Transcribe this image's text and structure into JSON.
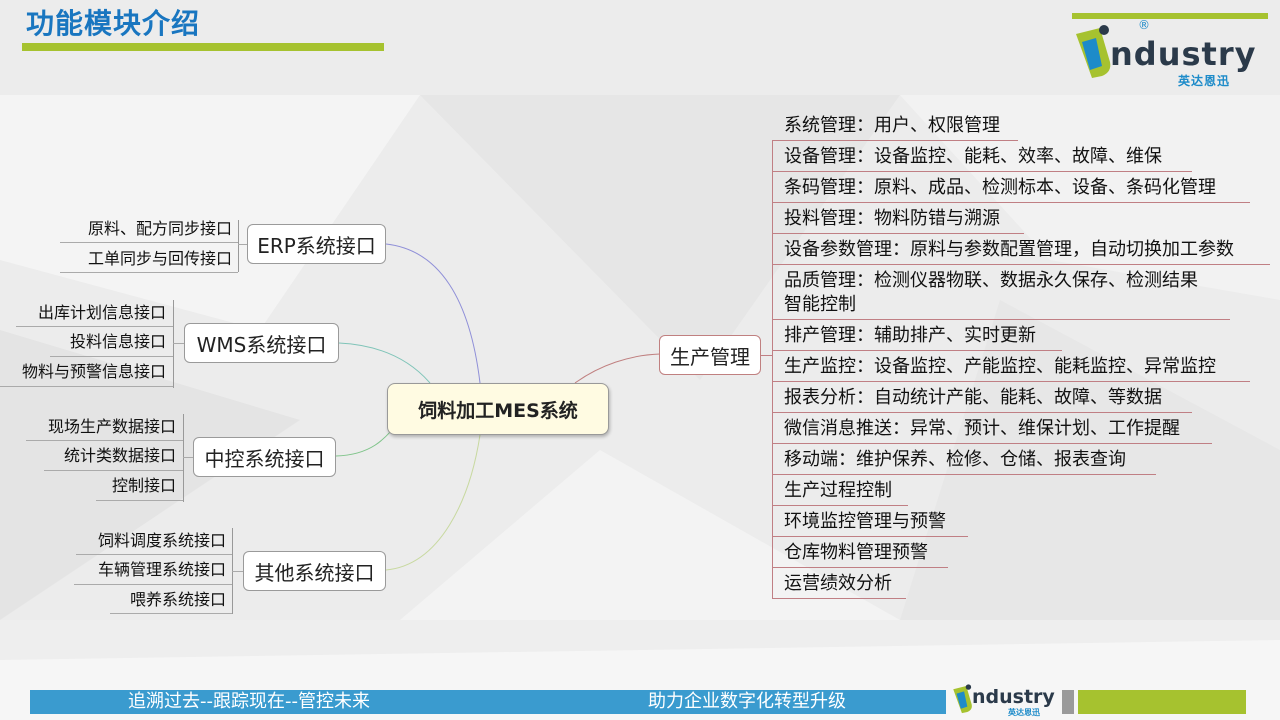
{
  "header": {
    "title": "功能模块介绍"
  },
  "logo": {
    "word": "ndustry",
    "cn": "英达恩迅",
    "reg": "®"
  },
  "mindmap": {
    "central": "饲料加工MES系统",
    "left_branches": [
      {
        "label": "ERP系统接口",
        "items": [
          "原料、配方同步接口",
          "工单同步与回传接口"
        ]
      },
      {
        "label": "WMS系统接口",
        "items": [
          "出库计划信息接口",
          "投料信息接口",
          "物料与预警信息接口"
        ]
      },
      {
        "label": "中控系统接口",
        "items": [
          "现场生产数据接口",
          "统计类数据接口",
          "控制接口"
        ]
      },
      {
        "label": "其他系统接口",
        "items": [
          "饲料调度系统接口",
          "车辆管理系统接口",
          "喂养系统接口"
        ]
      }
    ],
    "right_branch": {
      "label": "生产管理",
      "items": [
        "系统管理：用户、权限管理",
        "设备管理：设备监控、能耗、效率、故障、维保",
        "条码管理：原料、成品、检测标本、设备、条码化管理",
        "投料管理：物料防错与溯源",
        "设备参数管理：原料与参数配置管理，自动切换加工参数",
        "品质管理：检测仪器物联、数据永久保存、检测结果",
        "智能控制",
        "排产管理：辅助排产、实时更新",
        "生产监控：设备监控、产能监控、能耗监控、异常监控",
        "报表分析：自动统计产能、能耗、故障、等数据",
        "微信消息推送：异常、预计、维保计划、工作提醒",
        "移动端：维护保养、检修、仓储、报表查询",
        "生产过程控制",
        "环境监控管理与预警",
        "仓库物料管理预警",
        "运营绩效分析"
      ]
    }
  },
  "footer": {
    "left_text": "追溯过去--跟踪现在--管控未来",
    "right_text": "助力企业数字化转型升级"
  },
  "colors": {
    "title": "#1976c0",
    "accent_green": "#a6c22f",
    "footer_blue": "#3a9bcf",
    "right_lines": "#c07f84"
  }
}
